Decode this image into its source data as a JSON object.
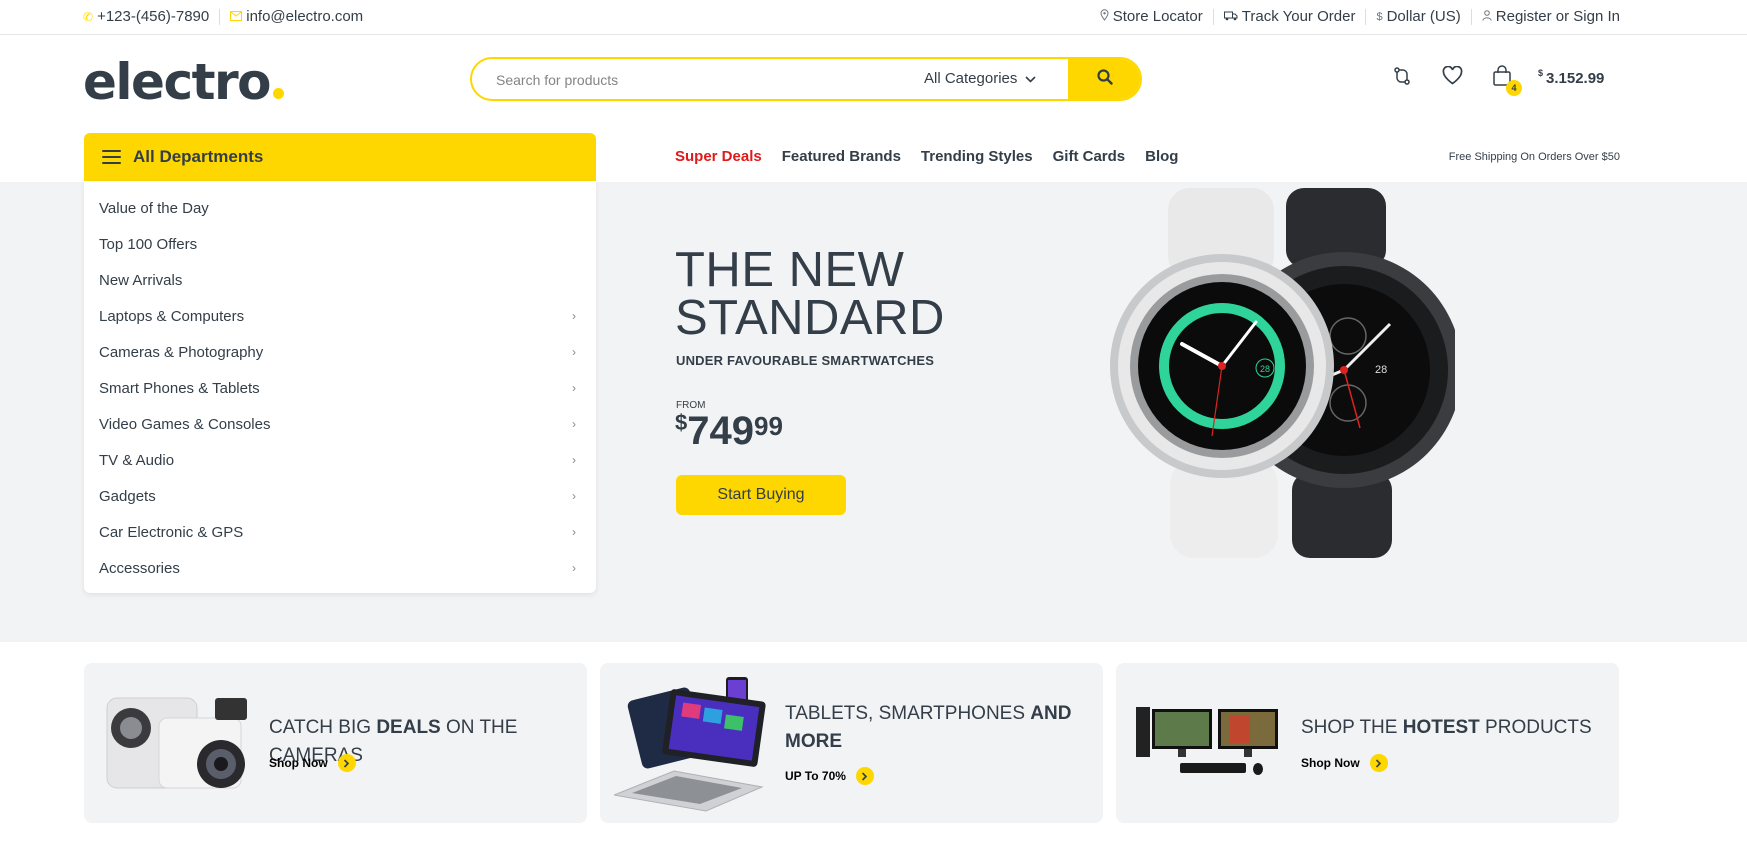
{
  "topbar": {
    "phone": "+123-(456)-7890",
    "email": "info@electro.com",
    "store_locator": "Store Locator",
    "track_order": "Track Your Order",
    "currency": "Dollar (US)",
    "account": "Register or Sign In",
    "currency_symbol": "$"
  },
  "header": {
    "logo": "electro",
    "search_placeholder": "Search for products",
    "category_select": "All Categories",
    "cart_count": "4",
    "cart_currency": "$",
    "cart_total": "3.152.99"
  },
  "nav": {
    "departments_label": "All Departments",
    "links": [
      "Super Deals",
      "Featured Brands",
      "Trending Styles",
      "Gift Cards",
      "Blog"
    ],
    "shipping_note": "Free Shipping On Orders Over $50"
  },
  "departments": [
    {
      "label": "Value of the Day",
      "has_sub": false
    },
    {
      "label": "Top 100 Offers",
      "has_sub": false
    },
    {
      "label": "New Arrivals",
      "has_sub": false
    },
    {
      "label": "Laptops & Computers",
      "has_sub": true
    },
    {
      "label": "Cameras & Photography",
      "has_sub": true
    },
    {
      "label": "Smart Phones & Tablets",
      "has_sub": true
    },
    {
      "label": "Video Games & Consoles",
      "has_sub": true
    },
    {
      "label": "TV & Audio",
      "has_sub": true
    },
    {
      "label": "Gadgets",
      "has_sub": true
    },
    {
      "label": "Car Electronic & GPS",
      "has_sub": true
    },
    {
      "label": "Accessories",
      "has_sub": true
    }
  ],
  "hero": {
    "title_line1": "THE NEW",
    "title_line2": "STANDARD",
    "subtitle": "UNDER FAVOURABLE SMARTWATCHES",
    "from_label": "FROM",
    "price_currency": "$",
    "price_int": "749",
    "price_dec": "99",
    "cta": "Start Buying",
    "watch_date_left": "28",
    "watch_date_right": "28"
  },
  "banners": [
    {
      "pre": "CATCH BIG ",
      "bold": "DEALS",
      "post": " ON THE CAMERAS",
      "cta": "Shop Now"
    },
    {
      "pre": "TABLETS, SMARTPHONES ",
      "bold": "AND MORE",
      "post": "",
      "cta": "UP To 70%"
    },
    {
      "pre": "SHOP THE ",
      "bold": "HOTEST",
      "post": " PRODUCTS",
      "cta": "Shop Now"
    }
  ],
  "colors": {
    "accent": "#fed700",
    "text": "#333e48",
    "deal": "#df1a1a",
    "panel_bg": "#f2f3f5"
  }
}
